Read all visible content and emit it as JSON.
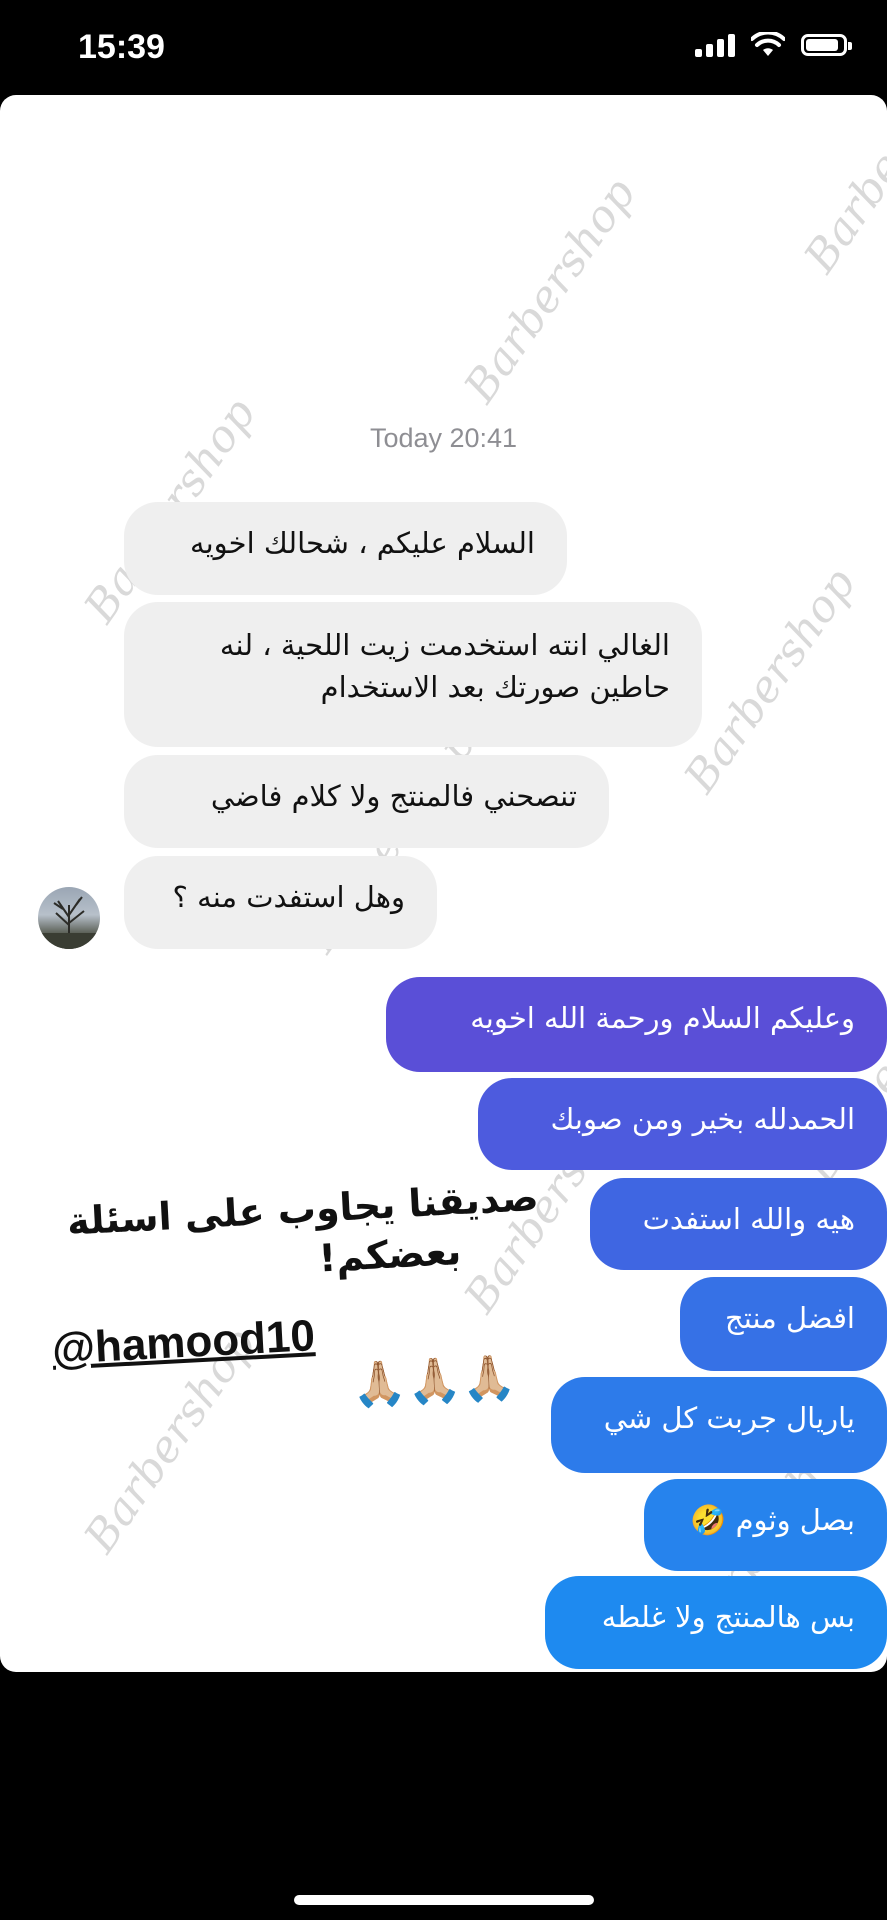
{
  "status_bar": {
    "time": "15:39"
  },
  "chat": {
    "timestamp": "Today 20:41",
    "incoming": [
      "السلام عليكم ، شحالك اخويه",
      "الغالي انته استخدمت زيت اللحية ، لنه\nحاطين صورتك بعد الاستخدام",
      "تنصحني فالمنتج ولا كلام فاضي",
      "وهل استفدت منه ؟"
    ],
    "outgoing": [
      "وعليكم السلام  ورحمة الله اخويه",
      "الحمدلله بخير ومن صوبك",
      "هيه والله استفدت",
      "افضل منتج",
      "ياريال جربت كل شي",
      "بصل وثوم 🤣",
      "بس هالمنتج ولا غلطه"
    ]
  },
  "overlay": {
    "line1": "صديقنا يجاوب على اسئلة",
    "line2": "بعضكم!",
    "handle": "@hamood10",
    "emoji": "🙏🏼🙏🏼🙏🏼"
  },
  "watermark_text": "Barbershop",
  "colors": {
    "gradient_top": "#5b4fd6",
    "gradient_bottom": "#1d8af0",
    "incoming_bg": "#efefef"
  }
}
